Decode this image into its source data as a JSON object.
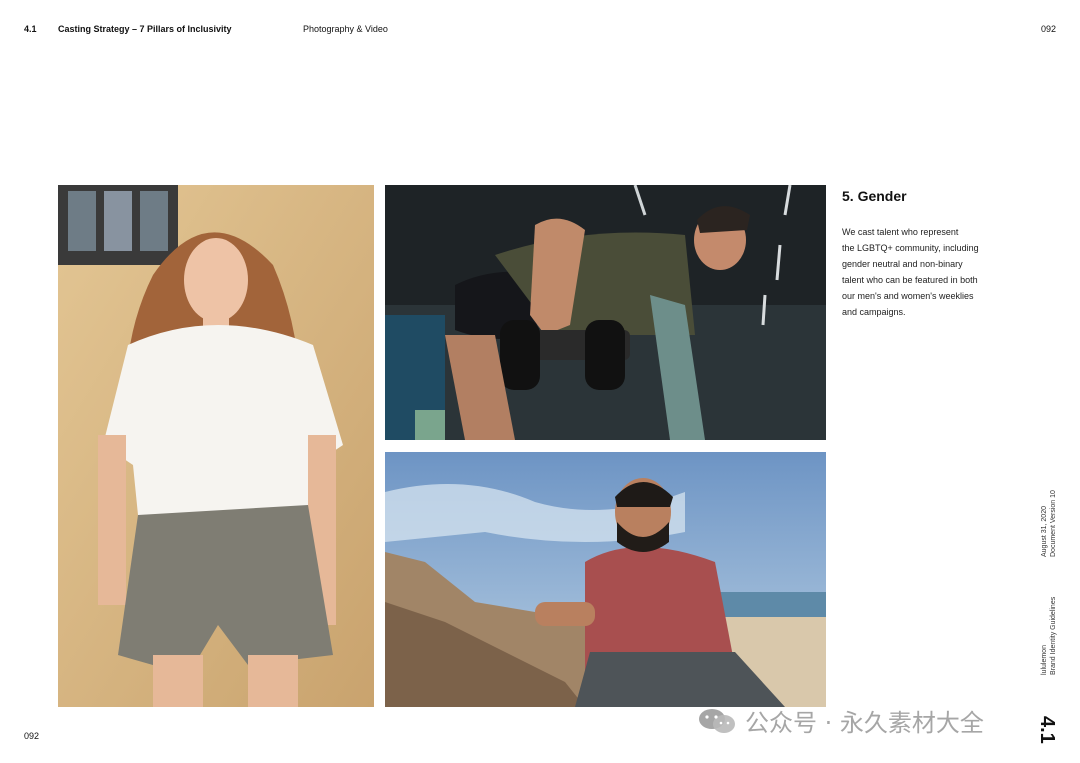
{
  "header": {
    "section_number": "4.1",
    "section_title": "Casting Strategy – 7 Pillars of Inclusivity",
    "category": "Photography & Video",
    "page_number": "092"
  },
  "content": {
    "heading": "5. Gender",
    "lines": [
      "We cast talent who represent",
      "the LGBTQ+ community, including",
      "gender neutral and non-binary",
      "talent who can be featured in both",
      "our men's and women's weeklies",
      "and campaigns."
    ]
  },
  "sidebar": {
    "date": "August 31, 2020",
    "version": "Document Version 10",
    "brand": "lululemon",
    "guide": "Brand Identity Guidelines"
  },
  "footer": {
    "page_number": "092",
    "section_mark": "4.1"
  },
  "watermark": {
    "text": "公众号 · 永久素材大全"
  }
}
